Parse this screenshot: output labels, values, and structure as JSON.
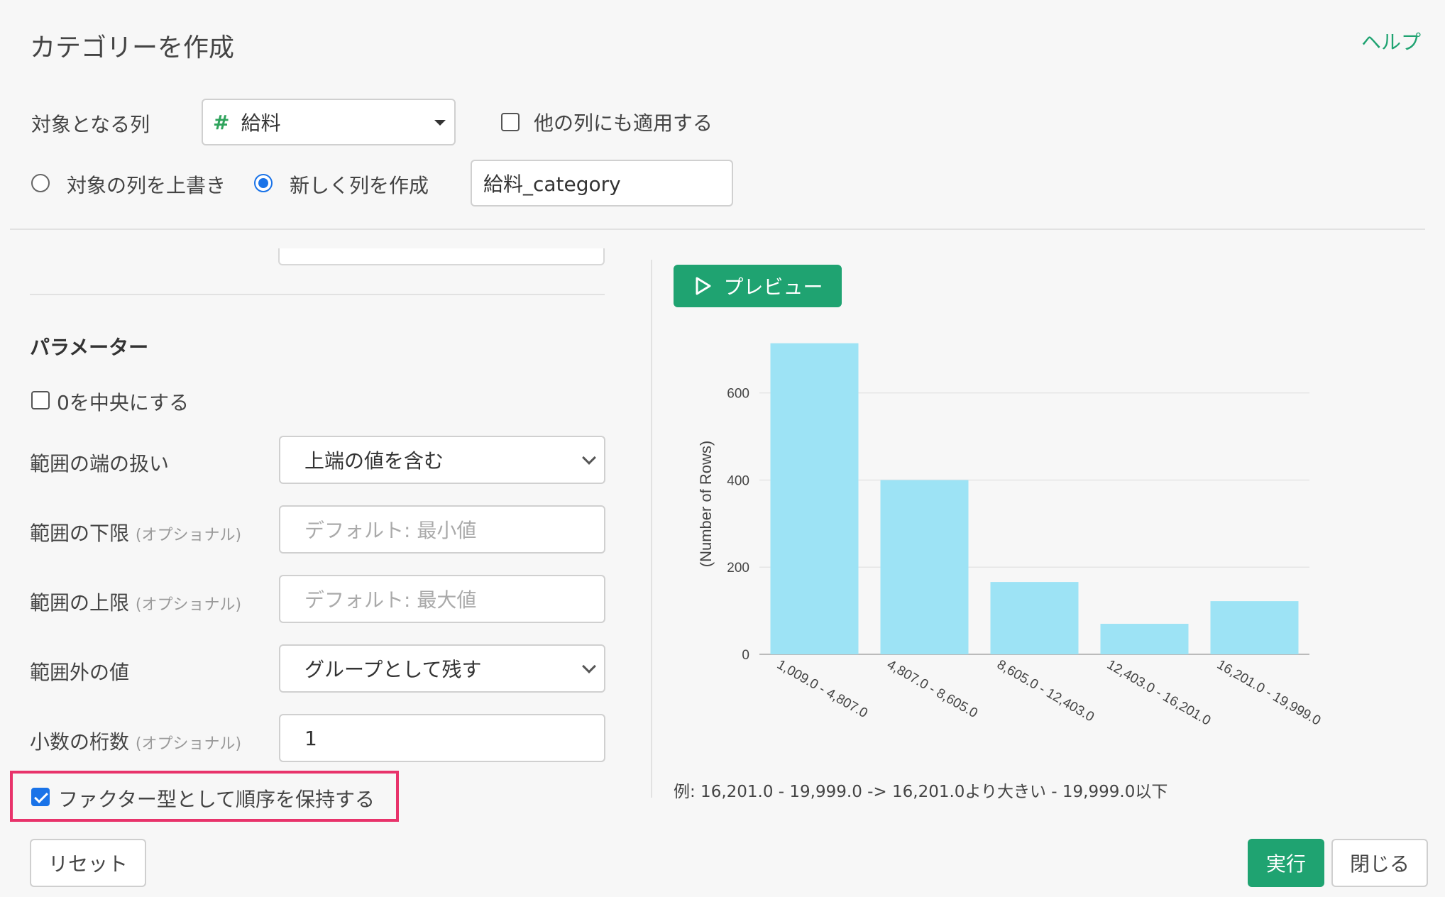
{
  "dialog": {
    "title": "カテゴリーを作成",
    "help": "ヘルプ"
  },
  "target": {
    "label": "対象となる列",
    "column_value": "給料",
    "apply_other_label": "他の列にも適用する",
    "apply_other_checked": false
  },
  "output": {
    "overwrite_label": "対象の列を上書き",
    "create_new_label": "新しく列を作成",
    "selected": "create_new",
    "new_column_name": "給料_category"
  },
  "params": {
    "heading": "パラメーター",
    "center_zero_label": "0を中央にする",
    "center_zero_checked": false,
    "range_edge_label": "範囲の端の扱い",
    "range_edge_value": "上端の値を含む",
    "lower_label": "範囲の下限",
    "lower_optional": "(オプショナル)",
    "lower_placeholder": "デフォルト: 最小値",
    "upper_label": "範囲の上限",
    "upper_optional": "(オプショナル)",
    "upper_placeholder": "デフォルト: 最大値",
    "outside_label": "範囲外の値",
    "outside_value": "グループとして残す",
    "decimals_label": "小数の桁数",
    "decimals_optional": "(オプショナル)",
    "decimals_value": "1",
    "factor_label": "ファクター型として順序を保持する",
    "factor_checked": true
  },
  "preview": {
    "button_label": "プレビュー",
    "example_text": "例: 16,201.0 - 19,999.0 -> 16,201.0より大きい - 19,999.0以下"
  },
  "chart_data": {
    "type": "bar",
    "categories": [
      "1,009.0 - 4,807.0",
      "4,807.0 - 8,605.0",
      "8,605.0 - 12,403.0",
      "12,403.0 - 16,201.0",
      "16,201.0 - 19,999.0"
    ],
    "values": [
      714,
      400,
      166,
      70,
      122
    ],
    "ylabel": "(Number of Rows)",
    "yticks": [
      0,
      200,
      400,
      600
    ],
    "ylim": [
      0,
      720
    ],
    "bar_color": "#9de3f5",
    "grid": true
  },
  "footer": {
    "reset": "リセット",
    "run": "実行",
    "close": "閉じる"
  },
  "colors": {
    "accent_green": "#1fa371",
    "accent_blue": "#1a73e8",
    "highlight": "#e8336b"
  }
}
